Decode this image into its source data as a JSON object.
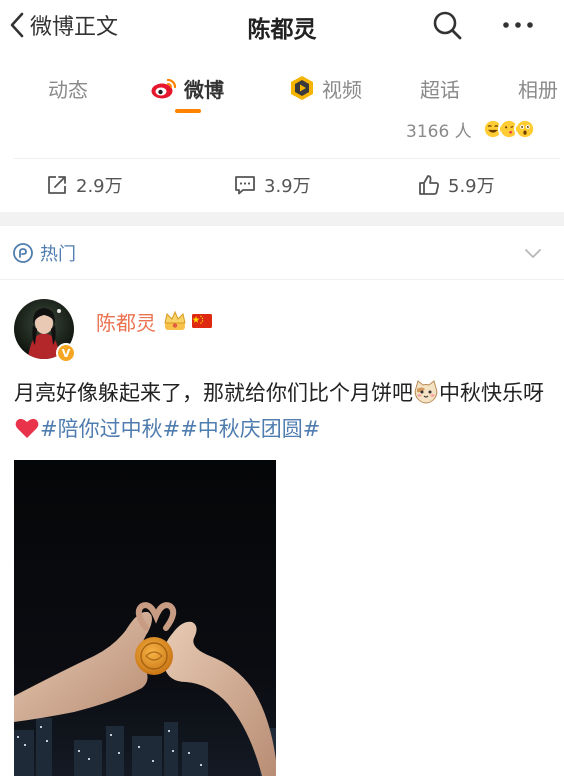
{
  "header": {
    "back_label": "微博正文",
    "title": "陈都灵",
    "search_icon": "search-icon",
    "more_icon": "more-dots-icon"
  },
  "tabs": [
    {
      "label": "动态",
      "active": false
    },
    {
      "label": "微博",
      "active": true,
      "icon": "weibo-logo-icon"
    },
    {
      "label": "视频",
      "active": false,
      "icon": "video-icon"
    },
    {
      "label": "超话",
      "active": false
    },
    {
      "label": "相册",
      "active": false
    }
  ],
  "reactions": {
    "count": "3166 人",
    "emojis": [
      "laughing-face",
      "kissing-face",
      "surprised-face"
    ]
  },
  "actions": {
    "repost": "2.9万",
    "comment": "3.9万",
    "like": "5.9万"
  },
  "hot": {
    "label": "热门",
    "icon": "hot-icon"
  },
  "post": {
    "author": "陈都灵",
    "verified_badge": "V",
    "text_main": "月亮好像躲起来了，那就给你们比个月饼吧",
    "text_second": "中秋快乐呀",
    "hashtag_1": "#陪你过中秋#",
    "hashtag_2": "#中秋庆团圆#",
    "photo": "hands-heart-mooncake-photo"
  },
  "colors": {
    "accent_orange": "#ff8200",
    "author_name": "#eb7350",
    "link_blue": "#507daf",
    "gap_gray": "#f2f2f2"
  }
}
